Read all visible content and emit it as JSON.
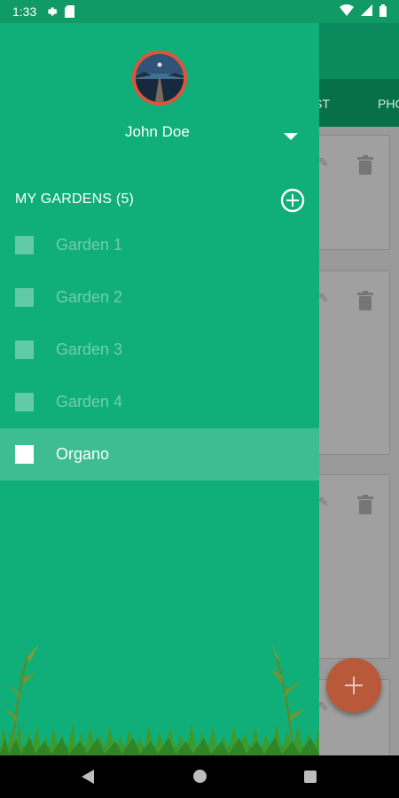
{
  "status_bar": {
    "time": "1:33"
  },
  "background": {
    "tabs": [
      "ST",
      "PHO"
    ]
  },
  "drawer": {
    "user_name": "John Doe",
    "section_title": "MY GARDENS (5)",
    "gardens": [
      {
        "label": "Garden 1",
        "selected": false
      },
      {
        "label": "Garden 2",
        "selected": false
      },
      {
        "label": "Garden 3",
        "selected": false
      },
      {
        "label": "Garden 4",
        "selected": false
      },
      {
        "label": "Organo",
        "selected": true
      }
    ]
  },
  "colors": {
    "drawer_bg": "#10ae78",
    "selected_row": "#3dbd91",
    "avatar_ring": "#e2543a",
    "fab": "#b85a3a"
  }
}
